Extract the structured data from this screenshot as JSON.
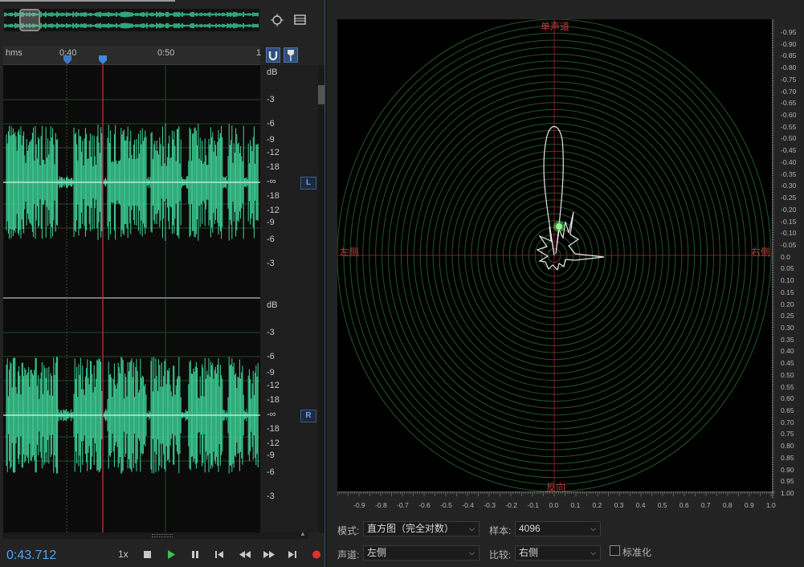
{
  "editor": {
    "ruler": {
      "unit": "hms",
      "marks": [
        "0:40",
        "0:50",
        "1"
      ]
    },
    "db_scale_left": [
      "dB",
      "-3",
      "-6",
      "-9",
      "-12",
      "-18",
      "-∞",
      "-18",
      "-12",
      "-9",
      "-6",
      "-3"
    ],
    "db_scale_right": [
      "dB",
      "-3",
      "-6",
      "-9",
      "-12",
      "-18",
      "-∞",
      "-18",
      "-12",
      "-9",
      "-6",
      "-3"
    ],
    "channel_left": "L",
    "channel_right": "R",
    "current_time": "0:43.712",
    "speed": "1x",
    "icons": [
      "zoom-icon",
      "list-icon",
      "magnet-icon",
      "marker-icon",
      "stop-icon",
      "play-icon",
      "pause-icon",
      "skip-start-icon",
      "rewind-icon",
      "fast-forward-icon",
      "skip-end-icon",
      "record-icon"
    ],
    "colors": {
      "waveform": "#3fd59a",
      "playhead": "#c53a3a",
      "time": "#4ea1f0",
      "record": "#e03030"
    }
  },
  "phase": {
    "labels": {
      "top": "单声道",
      "bottom": "反向",
      "left": "左侧",
      "right": "右侧"
    },
    "right_ticks": [
      "-0.95",
      "-0.90",
      "-0.85",
      "-0.80",
      "-0.75",
      "-0.70",
      "-0.65",
      "-0.60",
      "-0.55",
      "-0.50",
      "-0.45",
      "-0.40",
      "-0.35",
      "-0.30",
      "-0.25",
      "-0.20",
      "-0.15",
      "-0.10",
      "-0.05",
      "0.0",
      "0.05",
      "0.10",
      "0.15",
      "0.20",
      "0.25",
      "0.30",
      "0.35",
      "0.40",
      "0.45",
      "0.50",
      "0.55",
      "0.60",
      "0.65",
      "0.70",
      "0.75",
      "0.80",
      "0.85",
      "0.90",
      "0.95",
      "1.00"
    ],
    "bottom_ticks": [
      "-0.9",
      "-0.8",
      "-0.7",
      "-0.6",
      "-0.5",
      "-0.4",
      "-0.3",
      "-0.2",
      "-0.1",
      "0.0",
      "0.1",
      "0.2",
      "0.3",
      "0.4",
      "0.5",
      "0.6",
      "0.7",
      "0.8",
      "0.9",
      "1.0"
    ],
    "colors": {
      "rings": "#1f5a28",
      "axis": "#8a1c1c",
      "trace": "#e8e8e8",
      "dot": "#5fd35f"
    }
  },
  "controls": {
    "mode_label": "模式:",
    "mode_value": "直方图（完全对数）",
    "samples_label": "样本:",
    "samples_value": "4096",
    "channel_label": "声道:",
    "channel_value": "左侧",
    "compare_label": "比较:",
    "compare_value": "右侧",
    "normalize_label": "标准化",
    "normalize_checked": false
  }
}
